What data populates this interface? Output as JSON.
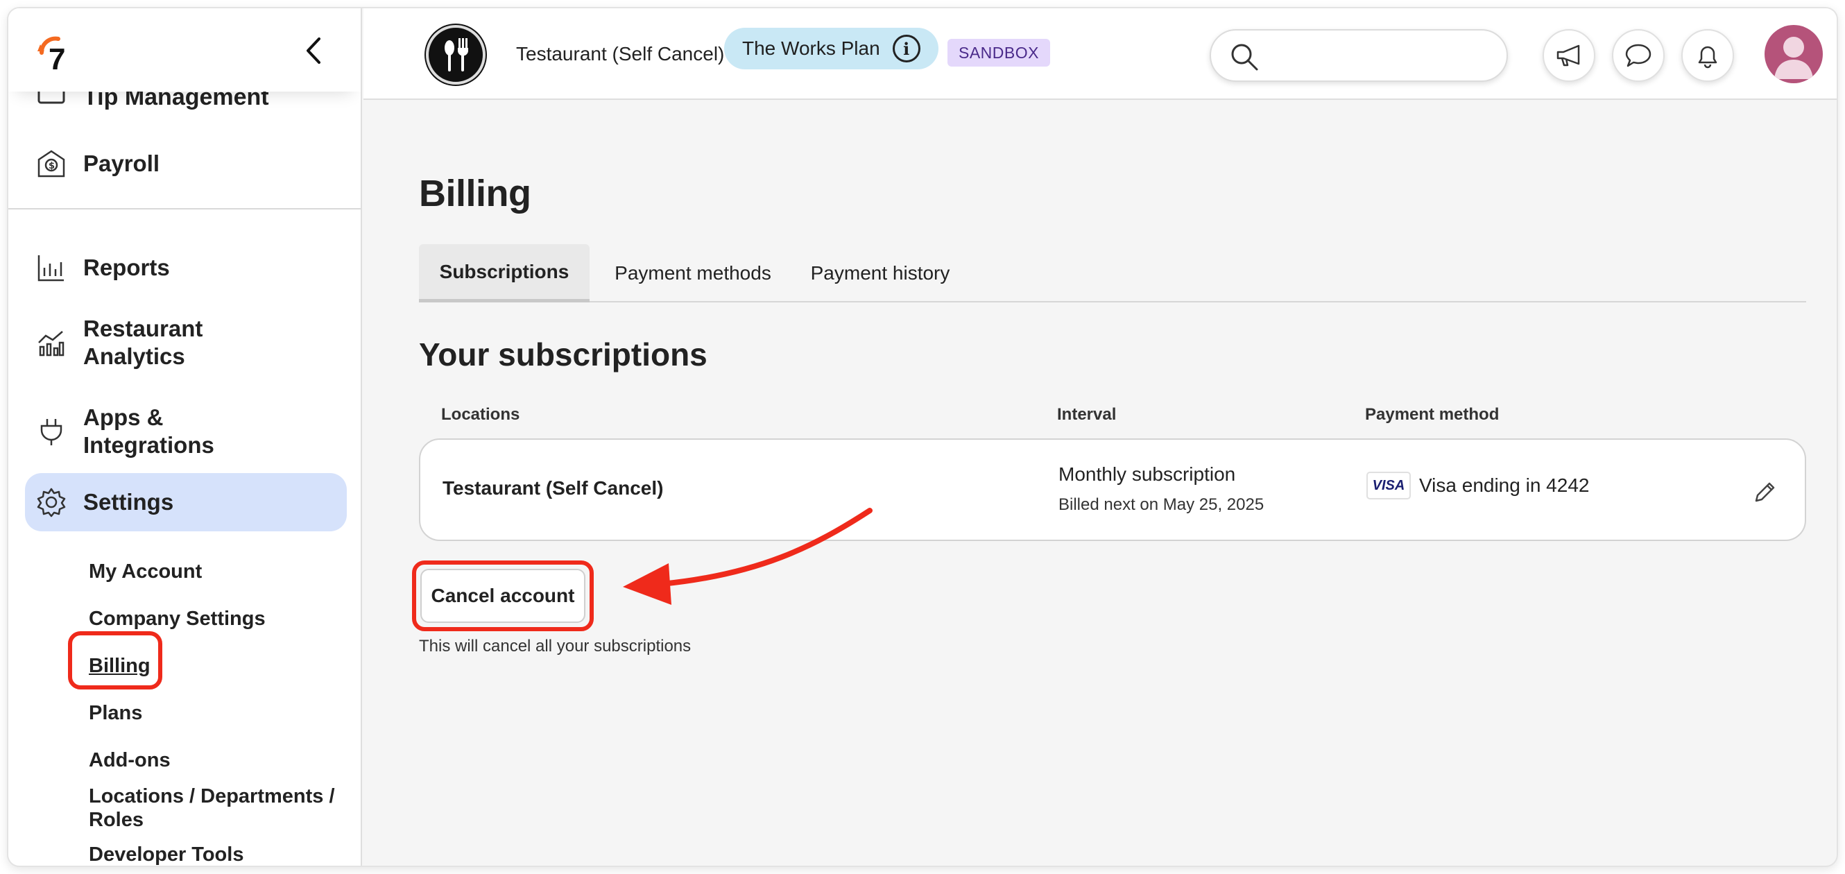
{
  "sidebar": {
    "partial_item_label": "Tip Management",
    "items": [
      {
        "label": "Payroll",
        "icon": "payroll-icon"
      },
      {
        "label": "Reports",
        "icon": "reports-icon"
      },
      {
        "label": "Restaurant Analytics",
        "line1": "Restaurant",
        "line2": "Analytics",
        "icon": "analytics-icon"
      },
      {
        "label": "Apps & Integrations",
        "line1": "Apps &",
        "line2": "Integrations",
        "icon": "plug-icon"
      },
      {
        "label": "Settings",
        "icon": "gear-icon"
      }
    ],
    "settings_sub": [
      {
        "label": "My Account"
      },
      {
        "label": "Company Settings"
      },
      {
        "label": "Billing"
      },
      {
        "label": "Plans"
      },
      {
        "label": "Add-ons"
      },
      {
        "label": "Locations / Departments /",
        "line2": "Roles"
      },
      {
        "label": "Developer Tools"
      }
    ],
    "logo_text": "7",
    "accent_color": "#f46a21",
    "active_bg": "#d6e2fb"
  },
  "header": {
    "restaurant_name": "Testaurant (Self Cancel)",
    "plan_label": "The Works Plan",
    "plan_info_glyph": "i",
    "env_badge": "SANDBOX",
    "search_placeholder": ""
  },
  "main": {
    "title": "Billing",
    "tabs": [
      {
        "label": "Subscriptions",
        "active": true
      },
      {
        "label": "Payment methods",
        "active": false
      },
      {
        "label": "Payment history",
        "active": false
      }
    ],
    "section_title": "Your subscriptions",
    "columns": [
      "Locations",
      "Interval",
      "Payment method"
    ],
    "subscriptions": [
      {
        "location": "Testaurant (Self Cancel)",
        "interval": "Monthly subscription",
        "billed_next": "Billed next on May 25, 2025",
        "card_brand": "VISA",
        "payment_method": "Visa ending in 4242"
      }
    ],
    "cancel_button": "Cancel account",
    "cancel_note": "This will cancel all your subscriptions"
  },
  "annotation_color": "#ef2a1b"
}
